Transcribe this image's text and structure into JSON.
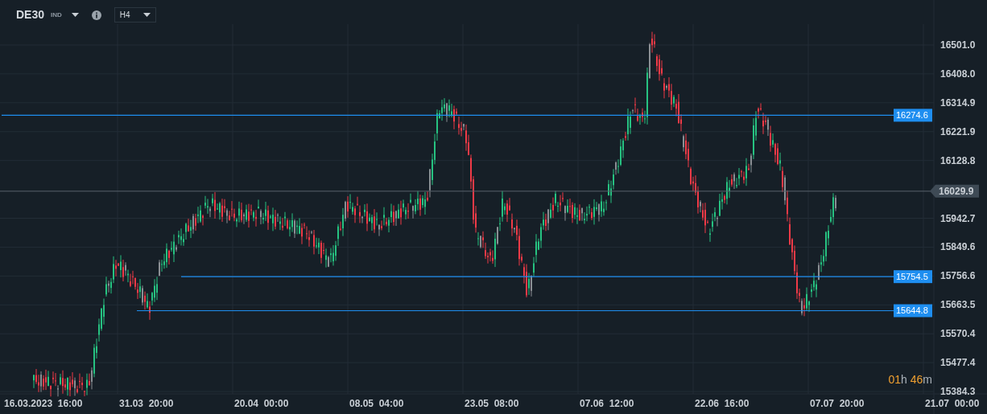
{
  "toolbar": {
    "symbol": "DE30",
    "market": "IND",
    "timeframe": "H4"
  },
  "price_axis": [
    "16501.0",
    "16408.0",
    "16314.9",
    "16221.9",
    "16128.8",
    "15942.7",
    "15849.6",
    "15756.6",
    "15663.5",
    "15570.4",
    "15477.4",
    "15384.3"
  ],
  "current_price": {
    "label": "16029.9"
  },
  "levels": [
    {
      "label": "16274.6"
    },
    {
      "label": "15754.5"
    },
    {
      "label": "15644.8"
    }
  ],
  "time_axis": [
    "16.03.2023  16:00",
    "31.03  20:00",
    "20.04  00:00",
    "08.05  04:00",
    "23.05  08:00",
    "07.06  12:00",
    "22.06  16:00",
    "07.07  20:00",
    "21.07  00:00"
  ],
  "countdown": {
    "hours": "01",
    "hours_unit": "h",
    "minutes": "46",
    "minutes_unit": "m"
  }
}
